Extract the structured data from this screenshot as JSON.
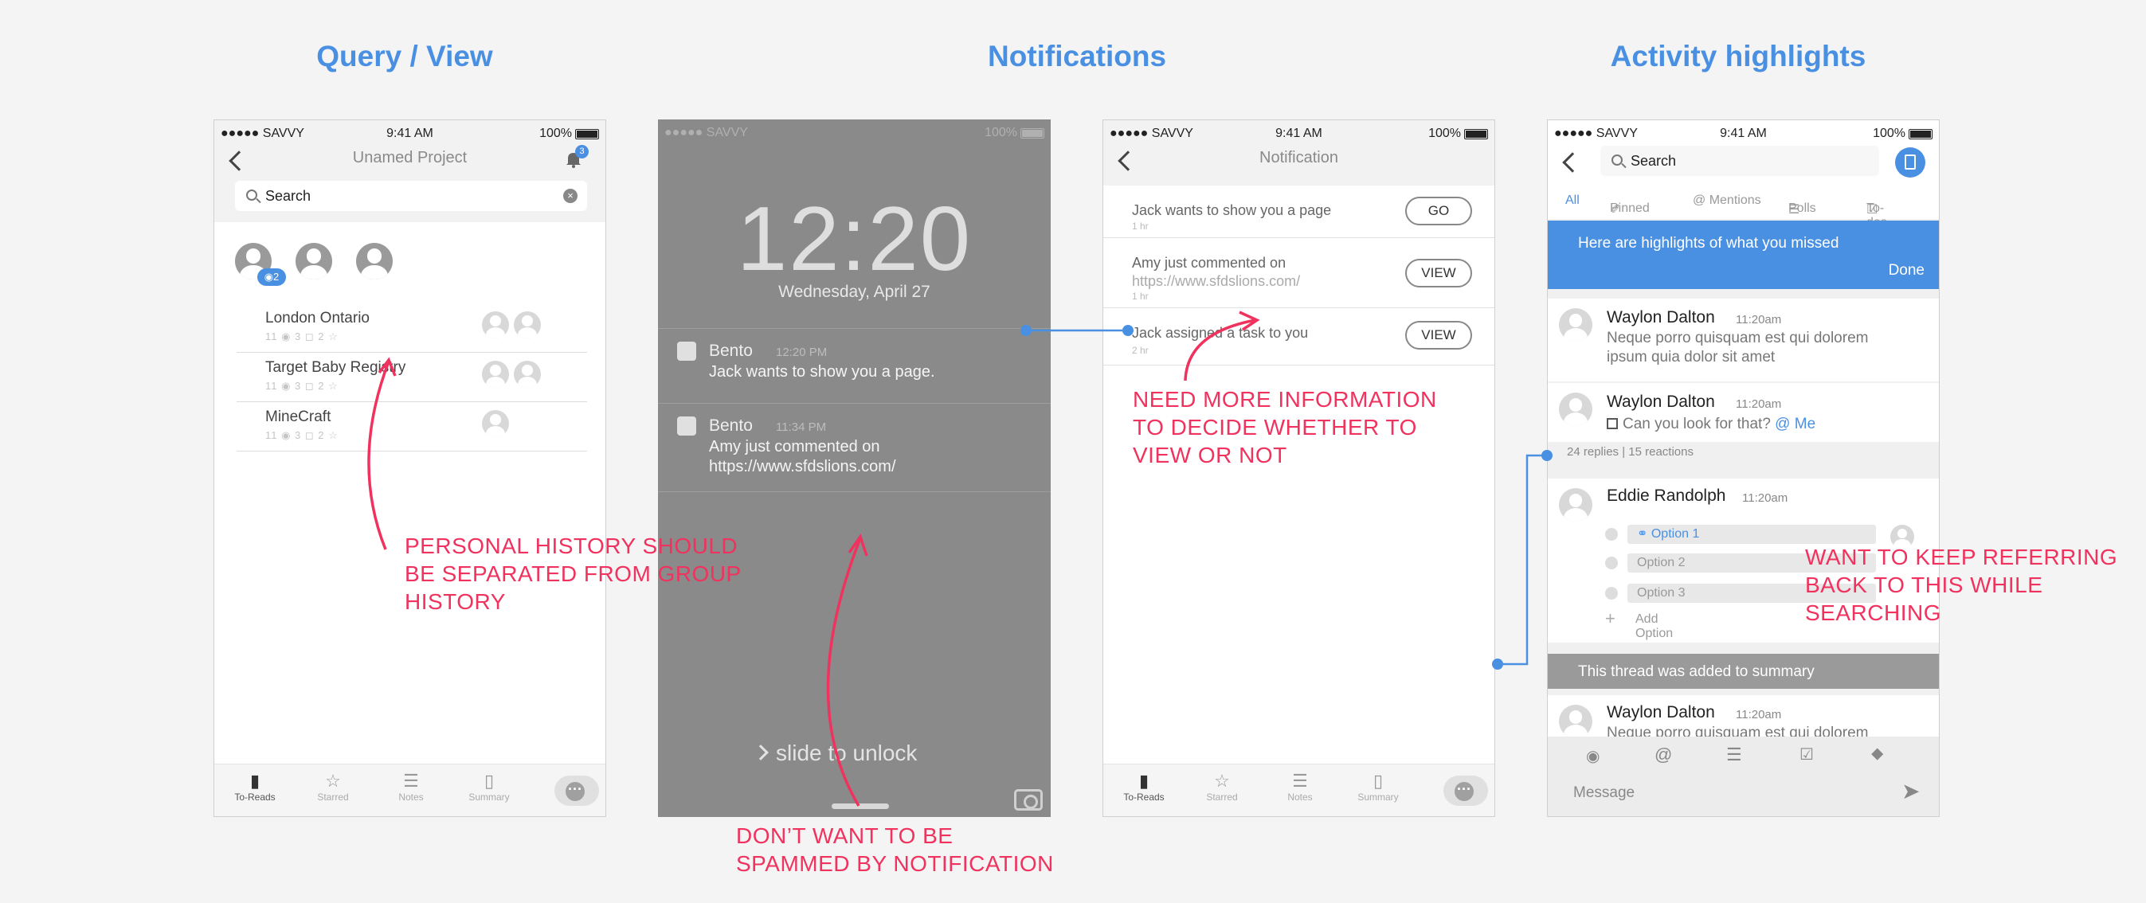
{
  "headings": {
    "query": "Query / View",
    "notifications": "Notifications",
    "activity": "Activity highlights"
  },
  "status": {
    "carrier": "●●●●● SAVVY",
    "time": "9:41 AM",
    "battery": "100%"
  },
  "lock_status": {
    "carrier": "●●●●● SAVVY",
    "battery": "100%"
  },
  "screen1": {
    "title": "Unamed Project",
    "bell_badge": "3",
    "search_value": "Search",
    "eye_badge": "2",
    "rows": [
      {
        "name": "London Ontario",
        "meta": "11 ◉  3 ◻  2 ☆"
      },
      {
        "name": "Target Baby Registry",
        "meta": "11 ◉  3 ◻  2 ☆"
      },
      {
        "name": "MineCraft",
        "meta": "11 ◉  3 ◻  2 ☆"
      }
    ],
    "tabs": [
      "To-Reads",
      "Starred",
      "Notes",
      "Summary"
    ],
    "chat_icon": "···"
  },
  "lockscreen": {
    "clock": "12:20",
    "date": "Wednesday, April 27",
    "notifications": [
      {
        "app": "Bento",
        "time": "12:20 PM",
        "msg": "Jack wants to show you a page."
      },
      {
        "app": "Bento",
        "time": "11:34 PM",
        "msg": "Amy just commented on https://www.sfdslions.com/"
      }
    ],
    "slide": "slide to unlock"
  },
  "screen3": {
    "title": "Notification",
    "items": [
      {
        "text": "Jack wants to show you a page",
        "link": "",
        "ago": "1 hr",
        "button": "GO"
      },
      {
        "text": "Amy just commented on ",
        "link": "https://www.sfdslions.com/",
        "ago": "1 hr",
        "button": "VIEW"
      },
      {
        "text": "Jack assigned a task to you",
        "link": "",
        "ago": "2 hr",
        "button": "VIEW"
      }
    ],
    "tabs": [
      "To-Reads",
      "Starred",
      "Notes",
      "Summary"
    ],
    "chat_icon": "···"
  },
  "screen4": {
    "search_value": "Search",
    "filters": [
      "All",
      "Pinned",
      "@ Mentions",
      "Polls",
      "To-dos"
    ],
    "banner_text": "Here are highlights of what you missed",
    "banner_done": "Done",
    "msg1": {
      "name": "Waylon Dalton",
      "time": "11:20am",
      "body": "Neque porro quisquam est qui dolorem ipsum quia dolor sit amet"
    },
    "msg2": {
      "name": "Waylon Dalton",
      "time": "11:20am",
      "body": "Can you look for that?",
      "mention": "@ Me"
    },
    "reactions": "24 replies | 15 reactions",
    "poll": {
      "name": "Eddie Randolph",
      "time": "11:20am",
      "options": [
        "Option 1",
        "Option 2",
        "Option 3"
      ],
      "add": "Add Option"
    },
    "summary_bar": "This thread was added to summary",
    "msg3": {
      "name": "Waylon Dalton",
      "time": "11:20am",
      "body": "Neque porro quisquam est qui dolorem"
    },
    "message_placeholder": "Message"
  },
  "annotations": {
    "personal": "PERSONAL HISTORY SHOULD BE SEPARATED FROM GROUP HISTORY",
    "spam": "DON’T WANT TO BE SPAMMED BY NOTIFICATION",
    "info": "NEED MORE INFORMATION TO DECIDE WHETHER TO VIEW OR NOT",
    "refer": "WANT TO KEEP REFERRING BACK TO THIS WHILE SEARCHING"
  },
  "colors": {
    "accent": "#4a90e2",
    "annotation": "#f0325e",
    "background": "#f4f4f4"
  }
}
